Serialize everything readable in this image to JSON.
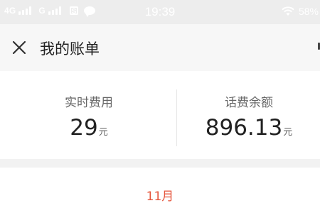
{
  "status_bar": {
    "network1": "4G",
    "network2": "G",
    "sim_icon_text": "S",
    "time": "19:39",
    "battery": "58%"
  },
  "header": {
    "title": "我的账单"
  },
  "summary": {
    "realtime_label": "实时费用",
    "realtime_value": "29",
    "realtime_unit": "元",
    "balance_label": "话费余额",
    "balance_value": "896.13",
    "balance_unit": "元"
  },
  "month_tabs": {
    "selected": "11月"
  },
  "colors": {
    "accent": "#e5553c",
    "background": "#f2f2f2"
  },
  "icons": [
    "close-icon",
    "signal-icon",
    "sim-icon",
    "message-icon",
    "wifi-icon"
  ]
}
